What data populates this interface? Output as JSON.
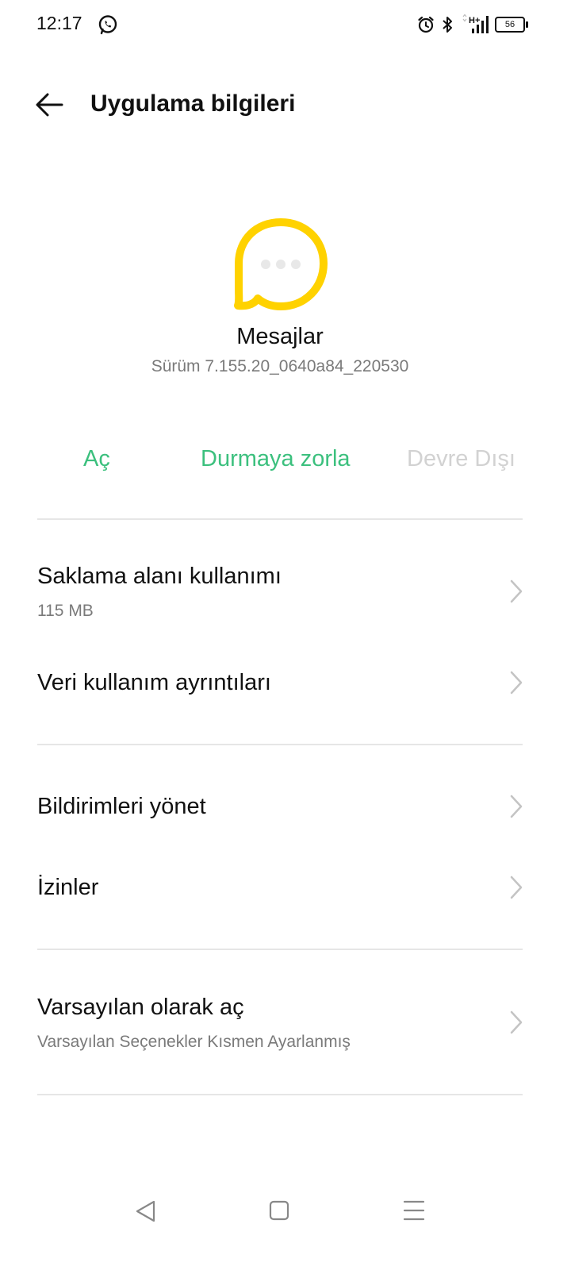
{
  "status_bar": {
    "time": "12:17",
    "battery": "56",
    "signal_label": "H+",
    "icons": [
      "whatsapp-icon",
      "alarm-icon",
      "bluetooth-icon",
      "signal-icon",
      "battery-icon"
    ]
  },
  "header": {
    "title": "Uygulama bilgileri",
    "back_icon": "arrow-left-icon"
  },
  "app": {
    "name": "Mesajlar",
    "version": "Sürüm 7.155.20_0640a84_220530",
    "icon": "chat-bubble-icon",
    "icon_color": "#FFD200"
  },
  "actions": {
    "open": "Aç",
    "force_stop": "Durmaya zorla",
    "disable": "Devre Dışı",
    "active_color": "#3CC07E",
    "disabled_color": "#D2D2D2"
  },
  "settings": {
    "storage": {
      "title": "Saklama alanı kullanımı",
      "subtitle": "115 MB"
    },
    "data_usage": {
      "title": "Veri kullanım ayrıntıları"
    },
    "notifications": {
      "title": "Bildirimleri yönet"
    },
    "permissions": {
      "title": "İzinler"
    },
    "open_by_default": {
      "title": "Varsayılan olarak aç",
      "subtitle": "Varsayılan Seçenekler Kısmen Ayarlanmış"
    }
  },
  "navbar": {
    "icons": [
      "back-triangle-icon",
      "home-square-icon",
      "menu-lines-icon"
    ]
  }
}
